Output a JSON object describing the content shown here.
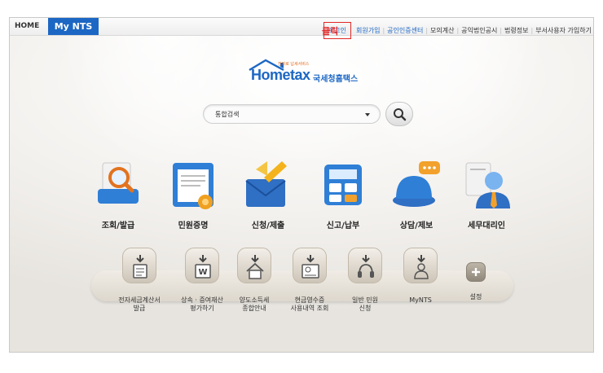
{
  "topbar": {
    "home": "HOME",
    "mynts": "My NTS",
    "links": [
      {
        "label": "로그인",
        "style": "hl"
      },
      {
        "label": "회원가입",
        "style": "hl"
      },
      {
        "label": "공인인증센터",
        "style": "hl"
      },
      {
        "label": "모의계산",
        "style": "dk"
      },
      {
        "label": "공익법인공시",
        "style": "dk"
      },
      {
        "label": "법령정보",
        "style": "dk"
      },
      {
        "label": "부서사용자 가입하기",
        "style": "dk"
      }
    ]
  },
  "annotation": {
    "click": "클릭",
    "color": "#e12828"
  },
  "logo": {
    "wordmark": "Hometax",
    "korean": "국세청홈택스",
    "tagline": "전자로 납세서비스"
  },
  "search": {
    "placeholder": "통합검색"
  },
  "menu": [
    {
      "label": "조회/발급",
      "icon": "magnifier-document-icon"
    },
    {
      "label": "민원증명",
      "icon": "certificate-icon"
    },
    {
      "label": "신청/제출",
      "icon": "envelope-pen-icon"
    },
    {
      "label": "신고/납부",
      "icon": "calculator-icon"
    },
    {
      "label": "상담/제보",
      "icon": "speech-bubble-icon"
    },
    {
      "label": "세무대리인",
      "icon": "tax-agent-icon"
    }
  ],
  "submenu": [
    {
      "label": "전자세금계산서\n발급",
      "icon": "invoice-icon"
    },
    {
      "label": "상속 · 증여재산\n평가하기",
      "icon": "won-document-icon"
    },
    {
      "label": "양도소득세\n종합안내",
      "icon": "house-icon"
    },
    {
      "label": "현금영수증\n사용내역 조회",
      "icon": "receipt-icon"
    },
    {
      "label": "일반 민원\n신청",
      "icon": "headset-icon"
    },
    {
      "label": "MyNTS",
      "icon": "mynts-icon"
    },
    {
      "label": "설정",
      "icon": "plus-icon"
    }
  ],
  "colors": {
    "brand": "#1c67c4",
    "accent": "#e26a1b",
    "highlight": "#e12828"
  }
}
